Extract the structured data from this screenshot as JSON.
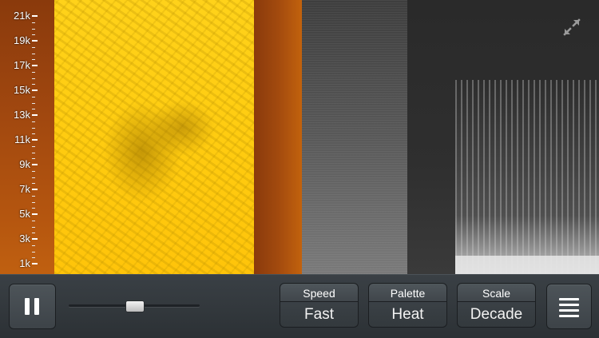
{
  "spectrogram": {
    "frequency_labels": [
      "21k",
      "19k",
      "17k",
      "15k",
      "13k",
      "11k",
      "9k",
      "7k",
      "5k",
      "3k",
      "1k"
    ]
  },
  "icons": {
    "expand": "expand-icon",
    "pause": "pause-icon",
    "menu": "menu-icon"
  },
  "controls": {
    "volume_level": 0.5,
    "speed": {
      "title": "Speed",
      "value": "Fast"
    },
    "palette": {
      "title": "Palette",
      "value": "Heat"
    },
    "scale": {
      "title": "Scale",
      "value": "Decade"
    }
  },
  "colors": {
    "heat_yellow": "#ffcc10",
    "heat_orange": "#a0470f",
    "control_bar": "#343a3e"
  }
}
